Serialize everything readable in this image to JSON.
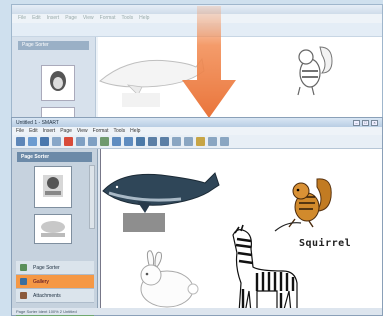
{
  "foreground": {
    "title": "Untitled 1 - SMART",
    "menu": [
      "File",
      "Edit",
      "Insert",
      "Page",
      "View",
      "Format",
      "Tools",
      "Help"
    ],
    "side_title": "Page Sorter",
    "side_menu": [
      {
        "label": "Page Sorter",
        "active": false
      },
      {
        "label": "Gallery",
        "active": true
      },
      {
        "label": "Attachments",
        "active": false
      }
    ],
    "canvas_label": "Squirrel",
    "status": "Page Sorter  Ident  100%  2 Untitled"
  },
  "background": {
    "menu": [
      "File",
      "Edit",
      "Insert",
      "Page",
      "View",
      "Format",
      "Tools",
      "Help"
    ],
    "side_title": "Page Sorter"
  },
  "colors": {
    "arrow": "#f08a4b",
    "active_tab": "#f59845",
    "titlebar": "#b8cde3"
  },
  "icons": [
    "down-arrow",
    "whale",
    "squirrel",
    "rabbit",
    "zebra",
    "chipmunk"
  ]
}
